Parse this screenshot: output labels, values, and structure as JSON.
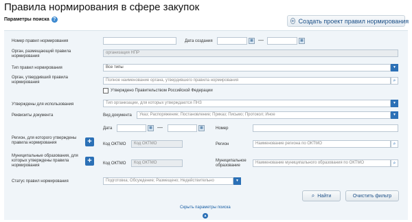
{
  "page": {
    "title": "Правила нормирования в сфере закупок"
  },
  "header": {
    "section_label": "Параметры поиска",
    "help_icon": "?",
    "create_button": "Создать проект правил нормирования",
    "create_icon": "+"
  },
  "form": {
    "rule_number": {
      "label": "Номер правил нормирования",
      "value": ""
    },
    "created": {
      "label": "Дата создания",
      "from": "",
      "to": "",
      "dash": "—"
    },
    "placing_org": {
      "label": "Орган, размещающий правила нормирования",
      "value": "организация НПР"
    },
    "rule_type": {
      "label": "Тип правил нормирования",
      "value": "Все типы"
    },
    "approving_org": {
      "label": "Орган, утвердивший правила нормирования",
      "placeholder": "Полное наименование органа, утвердившего правила нормирования"
    },
    "gov_approved": {
      "label": "Утверждено Правительством Российской Федерации",
      "checked": false
    },
    "approved_for": {
      "label": "Утверждены для использования",
      "value": "Тип организации, для которых утверждаются ПНЗ"
    },
    "doc_details": {
      "label": "Реквизиты документа",
      "doc_type_label": "Вид документа",
      "doc_type_value": "Указ; Распоряжение; Постановление; Приказ; Письмо; Протокол; Иное",
      "date_label": "Дата",
      "date_from": "",
      "date_to": "",
      "dash": "—",
      "number_label": "Номер",
      "number_value": ""
    },
    "region": {
      "label": "Регион, для которого утверждены правила нормирования",
      "oktmo_label": "Код ОКТМО",
      "oktmo_placeholder": "Код ОКТМО",
      "region_label": "Регион",
      "region_placeholder": "Наименование региона по ОКТМО"
    },
    "municipal": {
      "label": "Муниципальные образования, для которых утверждены правила нормирования",
      "oktmo_label": "Код ОКТМО",
      "oktmo_placeholder": "Код ОКТМО",
      "mo_label": "Муниципальное образование",
      "mo_placeholder": "Наименование муниципального образования по ОКТМО"
    },
    "status": {
      "label": "Статус правил нормирования",
      "value": "Подготовка; Обсуждение; Размещено; Недействительно"
    }
  },
  "actions": {
    "find": "Найти",
    "clear": "Очистить фильтр",
    "toggle": "Скрыть параметры поиска"
  },
  "icons": {
    "calendar": "calendar-icon",
    "search": "search-icon",
    "dropdown": "dropdown-arrow-icon",
    "plus": "plus-icon"
  },
  "colors": {
    "accent": "#2b70b6",
    "panel": "#f0f5f9",
    "link": "#1a5fa4"
  }
}
